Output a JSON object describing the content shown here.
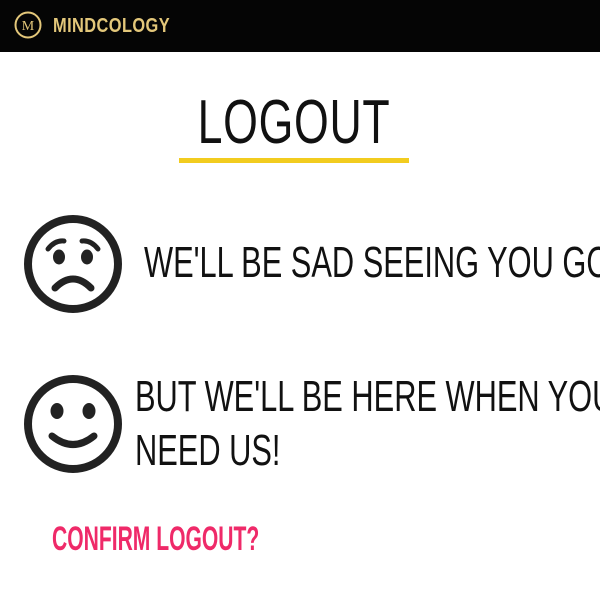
{
  "header": {
    "brand_name": "MINDCOLOGY",
    "logo_letter": "M",
    "brand_color": "#e3c77a",
    "bar_color": "#050505"
  },
  "main": {
    "title": "LOGOUT",
    "underline_color": "#f2cc1f",
    "messages": [
      {
        "icon": "sad-face-icon",
        "text": "WE'LL BE SAD SEEING YOU GO!"
      },
      {
        "icon": "smiley-face-icon",
        "lines": [
          "BUT WE'LL BE HERE WHEN YOU",
          "NEED US!"
        ]
      }
    ],
    "confirm_label": "CONFIRM LOGOUT?",
    "confirm_color": "#ef2a69"
  }
}
